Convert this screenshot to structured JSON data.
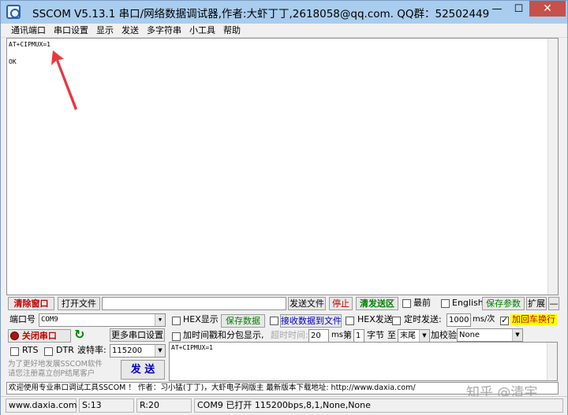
{
  "window": {
    "title": "SSCOM V5.13.1 串口/网络数据调试器,作者:大虾丁丁,2618058@qq.com. QQ群：52502449",
    "min_glyph": "—",
    "max_glyph": "☐",
    "close_glyph": "✕"
  },
  "menu": [
    "通讯端口",
    "串口设置",
    "显示",
    "发送",
    "多字符串",
    "小工具",
    "帮助"
  ],
  "receive": {
    "lines": [
      "AT+CIPMUX=1",
      "",
      "OK"
    ]
  },
  "annotation_color": "#e8383d",
  "toolbar": {
    "clear_window": "清除窗口",
    "open_file": "打开文件",
    "send_file": "发送文件",
    "stop": "停止",
    "clear_send": "清发送区",
    "topmost": "最前",
    "english": "English",
    "save_params": "保存参数",
    "expand": "扩展",
    "collapse": "—"
  },
  "port": {
    "port_label": "端口号",
    "port_value": "COM9",
    "hex_display": "HEX显示",
    "save_data": "保存数据",
    "recv_to_file": "接收数据到文件",
    "hex_send": "HEX发送",
    "timed_send": "定时发送:",
    "interval": "1000",
    "interval_unit": "ms/次",
    "append_newline": "加回车换行",
    "close_port": "关闭串口",
    "more_settings": "更多串口设置",
    "add_timestamp": "加时间戳和分包显示,",
    "timeout_label": "超时时间:",
    "timeout_value": "20",
    "timeout_unit": "ms",
    "byte_prefix": "第",
    "byte_index": "1",
    "byte_word": "字节",
    "to_word": "至",
    "end_option": "末尾",
    "checksum_label": "加校验",
    "checksum_value": "None",
    "rts": "RTS",
    "dtr": "DTR",
    "baud_label": "波特率:",
    "baud_value": "115200",
    "promo_line1": "为了更好地发展SSCOM软件",
    "promo_line2": "请您注册嘉立创P结尾客户",
    "send_button": "发 送",
    "send_text": "AT+CIPMUX=1"
  },
  "marquee": "欢迎使用专业串口调试工具SSCOM ！   作者：习小猛(丁丁)，大虾电子网版主   最新版本下载地址: http://www.daxia.com/",
  "watermark": "知乎 @清宇",
  "status": {
    "website": "www.daxia.com",
    "sent": "S:13",
    "received": "R:20",
    "port_status": "COM9 已打开  115200bps,8,1,None,None"
  }
}
